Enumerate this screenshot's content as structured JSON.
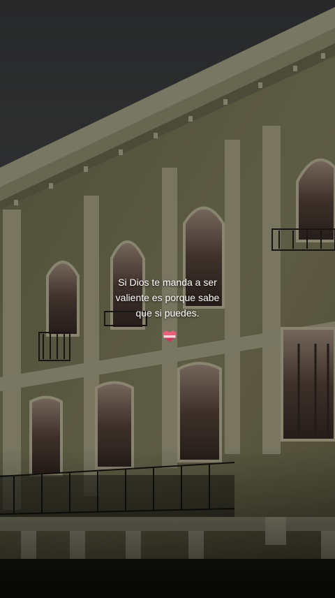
{
  "quote": {
    "lines": [
      "Si Dios te manda a ser",
      "valiente es porque sabe",
      "que si puedes."
    ]
  },
  "heart": {
    "icon": "heart-emoji-icon",
    "colors": [
      "#e8607a",
      "#f5d6dc",
      "#c9385a"
    ]
  },
  "palette": {
    "sky": "#3a3b3c",
    "facade": "#6b6a4e",
    "trim": "#9c9a83",
    "shadow": "#1c1c18"
  }
}
